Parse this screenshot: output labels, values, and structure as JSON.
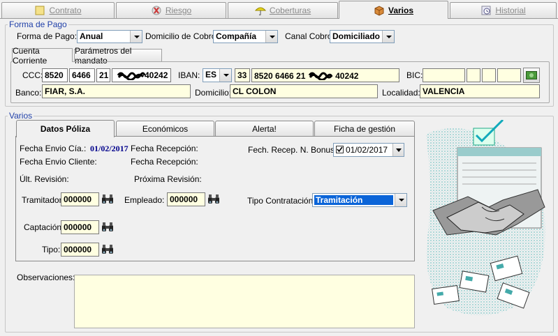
{
  "tabs": [
    {
      "label": "Contrato",
      "icon": "contract-icon",
      "active": false
    },
    {
      "label": "Riesgo",
      "icon": "risk-icon",
      "active": false
    },
    {
      "label": "Coberturas",
      "icon": "umbrella-icon",
      "active": false
    },
    {
      "label": "Varios",
      "icon": "box-icon",
      "active": true
    },
    {
      "label": "Historial",
      "icon": "history-icon",
      "active": false
    }
  ],
  "forma_pago": {
    "legend": "Forma de Pago",
    "forma_pago_label": "Forma de Pago:",
    "forma_pago_value": "Anual",
    "domicilio_cobro_label": "Domicilio de Cobro:",
    "domicilio_cobro_value": "Compañía",
    "canal_cobro_label": "Canal Cobro:",
    "canal_cobro_value": "Domiciliado",
    "subtabs": [
      "Cuenta Corriente",
      "Parámetros del mandato"
    ],
    "ccc_label": "CCC:",
    "ccc": [
      "8520",
      "6466",
      "21",
      "40242"
    ],
    "iban_label": "IBAN:",
    "iban_country": "ES",
    "iban_check": "33",
    "iban_number_start": "8520 6466 21",
    "iban_number_end": "40242",
    "bic_label": "BIC:",
    "banco_label": "Banco:",
    "banco_value": "FIAR, S.A.",
    "domicilio_label": "Domicilio:",
    "domicilio_value": "CL COLON",
    "localidad_label": "Localidad:",
    "localidad_value": "VALENCIA"
  },
  "varios": {
    "legend": "Varios",
    "tabs": [
      "Datos Póliza",
      "Económicos",
      "Alerta!",
      "Ficha de gestión"
    ],
    "fecha_envio_cia_label": "Fecha Envio Cía.:",
    "fecha_envio_cia_value": "01/02/2017",
    "fecha_recepcion_label_1": "Fecha Recepción:",
    "fech_recep_bonus_label": "Fech. Recep. N. Bonus:",
    "fech_recep_bonus_value": "01/02/2017",
    "fecha_envio_cliente_label": "Fecha Envio Cliente:",
    "fecha_recepcion_label_2": "Fecha Recepción:",
    "ult_revision_label": "Últ. Revisión:",
    "proxima_revision_label": "Próxima Revisión:",
    "tramitador_label": "Tramitador:",
    "tramitador_value": "000000",
    "empleado_label": "Empleado:",
    "empleado_value": "000000",
    "tipo_contratacion_label": "Tipo Contratación:",
    "tipo_contratacion_value": "Tramitación",
    "captacion_label": "Captación:",
    "captacion_value": "000000",
    "tipo_label": "Tipo:",
    "tipo_value": "000000",
    "observaciones_label": "Observaciones:"
  },
  "colors": {
    "legend": "#1f3fa8",
    "field_bg": "#ffffe1",
    "selection": "#0a64d8",
    "date_blue": "#00008b"
  }
}
